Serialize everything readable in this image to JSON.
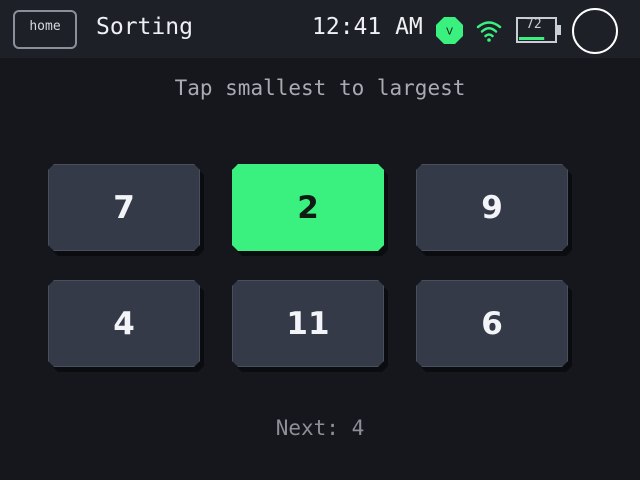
{
  "status_bar": {
    "home_label": "home",
    "app_title": "Sorting",
    "clock": "12:41 AM",
    "vpn_badge_letter": "V",
    "battery_level": "72",
    "battery_fraction": 0.72,
    "colors": {
      "accent": "#3af07e",
      "background": "#1e2028"
    },
    "icons": [
      "vpn-badge-icon",
      "wifi-icon",
      "battery-icon",
      "power-icon"
    ]
  },
  "main": {
    "instruction": "Tap smallest to largest",
    "tiles": [
      {
        "label": "7",
        "selected": false
      },
      {
        "label": "2",
        "selected": true
      },
      {
        "label": "9",
        "selected": false
      },
      {
        "label": "4",
        "selected": false
      },
      {
        "label": "11",
        "selected": false
      },
      {
        "label": "6",
        "selected": false
      }
    ],
    "next_text": "Next: 4",
    "colors": {
      "tile": "#353a48",
      "tile_selected": "#3af07e",
      "background": "#16171c"
    }
  }
}
